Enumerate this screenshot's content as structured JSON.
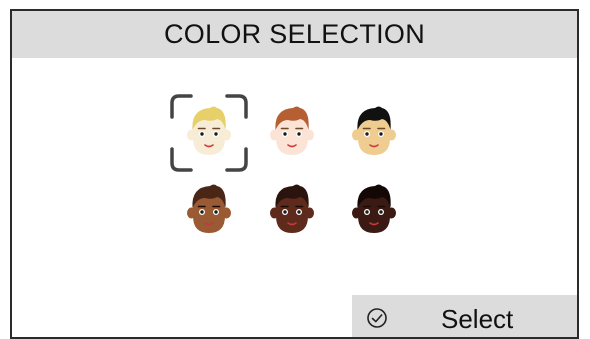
{
  "header": {
    "title": "COLOR SELECTION"
  },
  "faces": [
    {
      "skin": "#f7ecd6",
      "hair": "#e7cf6a",
      "selected": true
    },
    {
      "skin": "#fbe3d6",
      "hair": "#b55f33"
    },
    {
      "skin": "#efcc8f",
      "hair": "#111111"
    },
    {
      "skin": "#9a5a33",
      "hair": "#4a2617"
    },
    {
      "skin": "#5e2a1c",
      "hair": "#2b140d"
    },
    {
      "skin": "#3a1a12",
      "hair": "#140807"
    }
  ],
  "footer": {
    "select_label": "Select",
    "icon": "check-circle-icon"
  },
  "colors": {
    "bar": "#dcdcdc",
    "border": "#2b2b2b",
    "selector": "#444444"
  }
}
